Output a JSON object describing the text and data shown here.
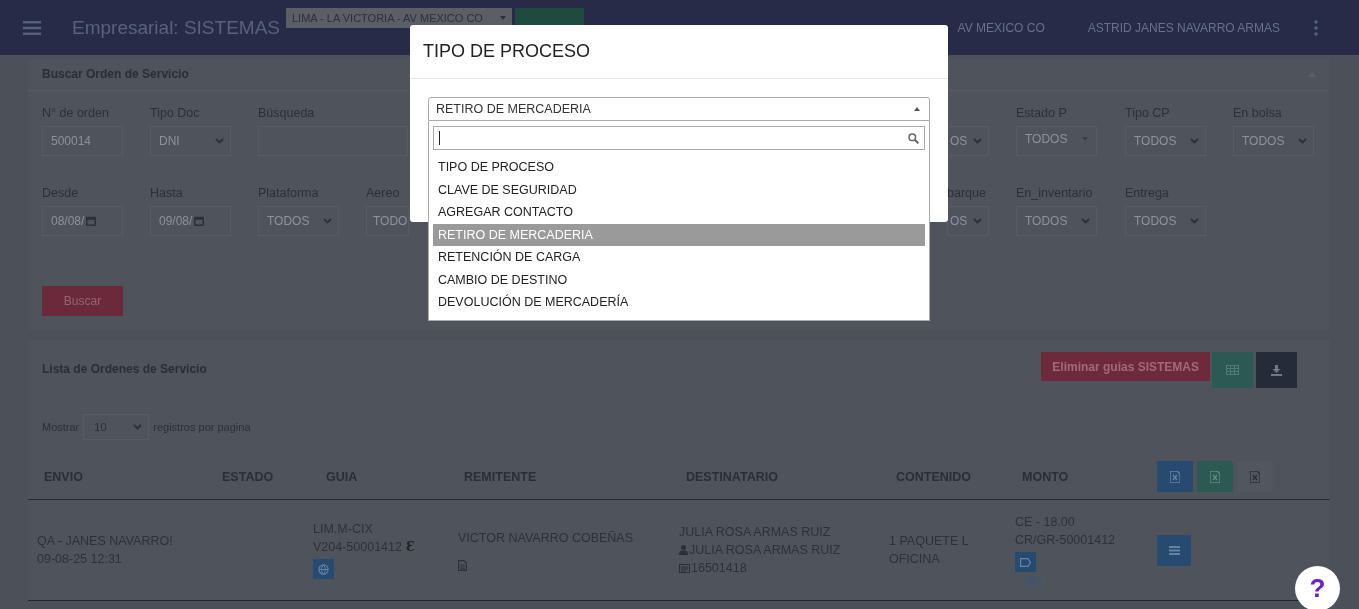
{
  "topbar": {
    "title": "Empresarial: SISTEMAS",
    "branch_select": "LIMA - LA VICTORIA - AV MEXICO CO",
    "location": "AV MEXICO CO",
    "user": "ASTRID JANES NAVARRO ARMAS"
  },
  "search_panel": {
    "title": "Buscar Orden de Servicio",
    "rows": [
      [
        {
          "kind": "input",
          "label": "N° de orden",
          "value": "500014"
        },
        {
          "kind": "select",
          "label": "Tipo Doc",
          "value": "DNI"
        },
        {
          "kind": "wide-input",
          "label": "Búsqueda"
        },
        {
          "kind": "covered"
        },
        {
          "kind": "edge-select",
          "value": "OS"
        },
        {
          "kind": "plain-select",
          "label": "Estado P",
          "value": "TODOS"
        },
        {
          "kind": "select",
          "label": "Tipo CP",
          "value": "TODOS"
        },
        {
          "kind": "select",
          "label": "En bolsa",
          "value": "TODOS"
        }
      ],
      [
        {
          "kind": "date",
          "label": "Desde",
          "value": "08/08/"
        },
        {
          "kind": "date",
          "label": "Hasta",
          "value": "09/08/"
        },
        {
          "kind": "select",
          "label": "Plataforma",
          "value": "TODOS"
        },
        {
          "kind": "clipped-select",
          "label": "Aereo",
          "value": "TODO"
        },
        {
          "kind": "edge-select",
          "label": "barque",
          "value": "OS"
        },
        {
          "kind": "select",
          "label": "En_inventario",
          "value": "TODOS"
        },
        {
          "kind": "select",
          "label": "Entrega",
          "value": "TODOS"
        }
      ]
    ],
    "search_button": "Buscar"
  },
  "list_panel": {
    "title": "Lista de Ordenes de Servicio",
    "delete_button": "Eliminar guias SISTEMAS",
    "page_size_label": "Mostrar",
    "page_size": "10",
    "page_size_suffix": "registros por pagina",
    "columns": [
      "ENVIO",
      "ESTADO",
      "GUIA",
      "REMITENTE",
      "DESTINATARIO",
      "CONTENIDO",
      "MONTO"
    ],
    "rows": [
      {
        "envio": [
          "QA - JANES NAVARRO!",
          "09-08-25 12:31"
        ],
        "guia": [
          "LIM.M-CIX",
          "V204-50001412"
        ],
        "guia_mark": "Ɛ",
        "remitente": "VICTOR NAVARRO COBEÑAS",
        "destinatario": "JULIA ROSA ARMAS RUIZ",
        "contact_name": "JULIA ROSA ARMAS RUIZ",
        "contact_id": "16501418",
        "contenido": [
          "1 PAQUETE L",
          "OFICINA"
        ],
        "monto": [
          "CE - 18.00",
          "CR/GR-50001412"
        ]
      }
    ]
  },
  "modal": {
    "title": "TIPO DE PROCESO",
    "select_value": "RETIRO DE MERCADERIA",
    "expanded": true,
    "options": [
      {
        "label": "TIPO DE PROCESO",
        "selected": false
      },
      {
        "label": "CLAVE DE SEGURIDAD",
        "selected": false
      },
      {
        "label": "AGREGAR CONTACTO",
        "selected": false
      },
      {
        "label": "RETIRO DE MERCADERIA",
        "selected": true
      },
      {
        "label": "RETENCIÓN DE CARGA",
        "selected": false
      },
      {
        "label": "CAMBIO DE DESTINO",
        "selected": false
      },
      {
        "label": "DEVOLUCIÓN DE MERCADERÍA",
        "selected": false
      }
    ]
  },
  "help_button": "?"
}
